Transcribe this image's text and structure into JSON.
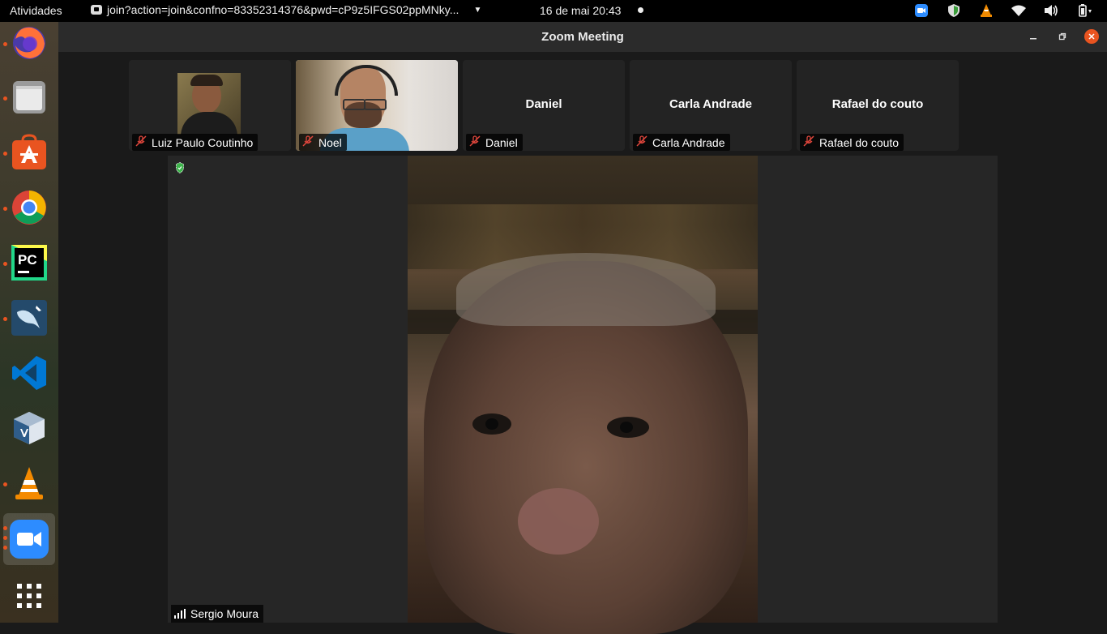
{
  "topbar": {
    "activities": "Atividades",
    "app_title": "join?action=join&confno=83352314376&pwd=cP9z5IFGS02ppMNky...",
    "clock": "16 de mai  20:43",
    "tray_icons": [
      "zoom-icon",
      "shield-update-icon",
      "vlc-icon",
      "wifi-icon",
      "volume-icon",
      "battery-icon"
    ]
  },
  "dock": {
    "apps": [
      {
        "name": "firefox",
        "running": true
      },
      {
        "name": "files",
        "running": true
      },
      {
        "name": "ubuntu-software",
        "running": true
      },
      {
        "name": "chrome",
        "running": true
      },
      {
        "name": "pycharm",
        "running": true
      },
      {
        "name": "mysql-workbench",
        "running": true
      },
      {
        "name": "vscode",
        "running": false
      },
      {
        "name": "virtualbox",
        "running": false
      },
      {
        "name": "vlc",
        "running": true
      },
      {
        "name": "zoom",
        "running": true,
        "active": true
      }
    ],
    "show_apps": "apps-grid"
  },
  "window": {
    "title": "Zoom Meeting",
    "controls": [
      "minimize",
      "maximize",
      "close"
    ],
    "accent": "#e95420"
  },
  "gallery": [
    {
      "name": "Luiz Paulo Coutinho",
      "has_video": true,
      "muted": true
    },
    {
      "name": "Noel",
      "has_video": true,
      "muted": true,
      "active": true
    },
    {
      "name": "Daniel",
      "display_name": "Daniel",
      "has_video": false,
      "muted": true
    },
    {
      "name": "Carla Andrade",
      "display_name": "Carla Andrade",
      "has_video": false,
      "muted": true
    },
    {
      "name": "Rafael do couto",
      "display_name": "Rafael do couto",
      "has_video": false,
      "muted": true
    }
  ],
  "speaker": {
    "name": "Sergio Moura"
  }
}
